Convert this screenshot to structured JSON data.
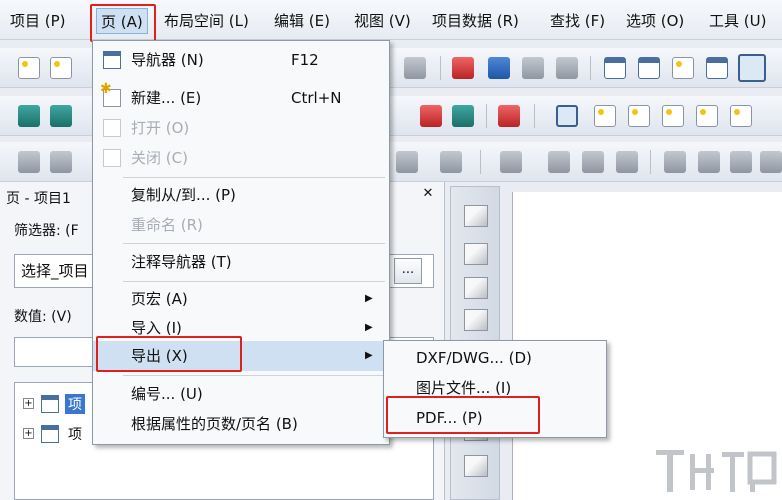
{
  "menubar": {
    "items": [
      {
        "label": "项目 (P)"
      },
      {
        "label": "页 (A)"
      },
      {
        "label": "布局空间 (L)"
      },
      {
        "label": "编辑 (E)"
      },
      {
        "label": "视图 (V)"
      },
      {
        "label": "项目数据 (R)"
      },
      {
        "label": "查找 (F)"
      },
      {
        "label": "选项 (O)"
      },
      {
        "label": "工具 (U)"
      }
    ]
  },
  "page_menu": {
    "items": [
      {
        "label": "导航器 (N)",
        "shortcut": "F12",
        "icon": "navigator-icon"
      },
      {
        "label": "新建... (E)",
        "shortcut": "Ctrl+N",
        "icon": "new-page-icon"
      },
      {
        "label": "打开 (O)",
        "icon": "open-icon",
        "disabled": true
      },
      {
        "label": "关闭 (C)",
        "icon": "close-page-icon",
        "disabled": true
      },
      {
        "label": "复制从/到... (P)"
      },
      {
        "label": "重命名 (R)",
        "disabled": true
      },
      {
        "label": "注释导航器 (T)"
      },
      {
        "label": "页宏 (A)",
        "submenu": true
      },
      {
        "label": "导入 (I)",
        "submenu": true
      },
      {
        "label": "导出 (X)",
        "submenu": true,
        "highlighted": true
      },
      {
        "label": "编号... (U)"
      },
      {
        "label": "根据属性的页数/页名 (B)"
      }
    ]
  },
  "export_submenu": {
    "items": [
      {
        "label": "DXF/DWG... (D)"
      },
      {
        "label": "图片文件... (I)"
      },
      {
        "label": "PDF... (P)"
      }
    ]
  },
  "left_panel": {
    "title": "页 - 项目1",
    "filter_label": "筛选器: (F",
    "filter_value": "选择_项目",
    "dots_label": "...",
    "value_label": "数值: (V)",
    "tree": [
      {
        "label": "项",
        "selected": true
      },
      {
        "label": "项"
      }
    ]
  },
  "highlight_color": "#e0201c"
}
